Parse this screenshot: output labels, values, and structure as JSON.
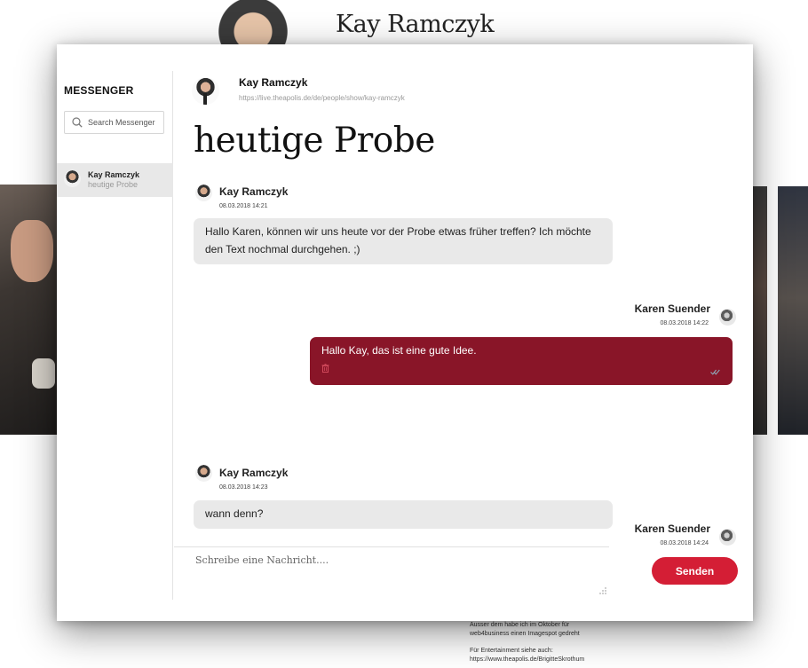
{
  "background": {
    "profile_name": "Kay Ramczyk",
    "footer_lines": [
      "Ausser dem habe ich im Oktober für",
      "web4business einen Imagespot gedreht",
      "Für Entertainment siehe auch:",
      "https://www.theapolis.de/BrigitteSkrothum"
    ]
  },
  "sidebar": {
    "title": "MESSENGER",
    "search_placeholder": "Search Messenger",
    "conversations": [
      {
        "name": "Kay Ramczyk",
        "subject": "heutige Probe"
      }
    ]
  },
  "header": {
    "contact_name": "Kay Ramczyk",
    "contact_url": "https://live.theapolis.de/de/people/show/kay-ramczyk",
    "conversation_title": "heutige Probe"
  },
  "messages": [
    {
      "sender": "Kay Ramczyk",
      "time": "08.03.2018 14:21",
      "text": "Hallo Karen, können wir uns heute vor der Probe etwas früher treffen? Ich möchte den Text nochmal durchgehen. ;)",
      "direction": "in"
    },
    {
      "sender": "Karen Suender",
      "time": "08.03.2018 14:22",
      "text": "Hallo Kay, das ist eine gute Idee.",
      "direction": "out"
    },
    {
      "sender": "Kay Ramczyk",
      "time": "08.03.2018 14:23",
      "text": "wann denn?",
      "direction": "in"
    },
    {
      "sender": "Karen Suender",
      "time": "08.03.2018 14:24",
      "text": "",
      "direction": "out"
    }
  ],
  "compose": {
    "placeholder": "Schreibe eine Nachricht....",
    "send_label": "Senden"
  },
  "colors": {
    "outgoing_bubble": "#891528",
    "incoming_bubble": "#e9e9e9",
    "send_button": "#d41e35"
  }
}
